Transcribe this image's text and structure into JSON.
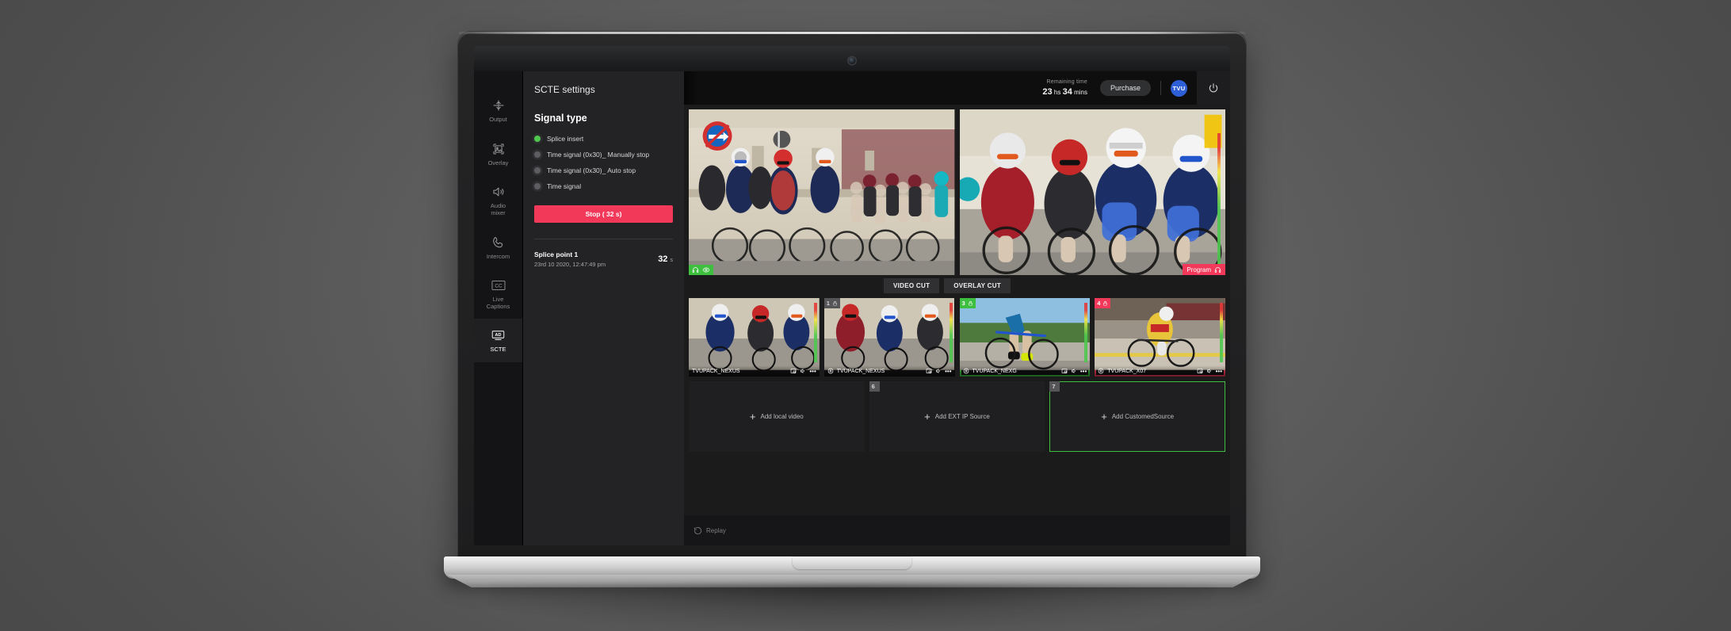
{
  "app": {
    "header": {
      "remaining_label": "Remaining time",
      "remaining_hours": "23",
      "remaining_hours_unit": "hs",
      "remaining_mins": "34",
      "remaining_mins_unit": "mins",
      "purchase_label": "Purchase",
      "logo_text": "TVU",
      "power_icon": "power-icon"
    },
    "sidebar": {
      "items": [
        {
          "label": "Output",
          "icon": "output-icon",
          "active": false
        },
        {
          "label": "Overlay",
          "icon": "overlay-image-icon",
          "active": false
        },
        {
          "label": "Audio\nmixer",
          "label_line1": "Audio",
          "label_line2": "mixer",
          "icon": "speaker-icon",
          "active": false
        },
        {
          "label": "Intercom",
          "icon": "phone-icon",
          "active": false
        },
        {
          "label": "Live\nCaptions",
          "label_line1": "Live",
          "label_line2": "Captions",
          "icon": "closed-caption-icon",
          "active": false
        },
        {
          "label": "SCTE",
          "icon": "ad-icon",
          "active": true
        }
      ]
    },
    "panel": {
      "title": "SCTE settings",
      "section_title": "Signal type",
      "options": [
        {
          "label": "Splice insert",
          "selected": true
        },
        {
          "label": "Time signal (0x30)_ Manually stop",
          "selected": false
        },
        {
          "label": "Time signal (0x30)_ Auto stop",
          "selected": false
        },
        {
          "label": "Time signal",
          "selected": false
        }
      ],
      "stop_button": "Stop ( 32 s)",
      "splice_point": {
        "name": "Splice point 1",
        "timestamp": "23rd 10 2020, 12:47:49 pm",
        "duration": "32",
        "duration_unit": "s"
      }
    },
    "stage": {
      "previews": [
        {
          "name": "preview-left",
          "badge": "monitor-chips"
        },
        {
          "name": "preview-right",
          "program_label": "Program"
        }
      ],
      "cut_buttons": [
        {
          "label": "VIDEO CUT"
        },
        {
          "label": "OVERLAY CUT"
        }
      ],
      "thumbnails": [
        {
          "number": "",
          "label": "TVUPACK_NEXUS",
          "state": "none"
        },
        {
          "number": "1",
          "label": "TVUPACK_NEXUS",
          "state": "gray"
        },
        {
          "number": "3",
          "label": "TVUPACK_NEXG",
          "state": "green"
        },
        {
          "number": "4",
          "label": "TVUPACK_X07",
          "state": "red"
        }
      ],
      "add_sources": [
        {
          "label": "Add local video",
          "number": ""
        },
        {
          "label": "Add EXT IP Source",
          "number": "6"
        },
        {
          "label": "Add CustomedSource",
          "number": "7"
        }
      ],
      "replay_label": "Replay"
    },
    "colors": {
      "accent_red": "#f2395a",
      "accent_green": "#3fbf3f",
      "panel_bg": "#232325",
      "sidebar_bg": "#141416",
      "brand_blue": "#2f5fd6"
    }
  }
}
